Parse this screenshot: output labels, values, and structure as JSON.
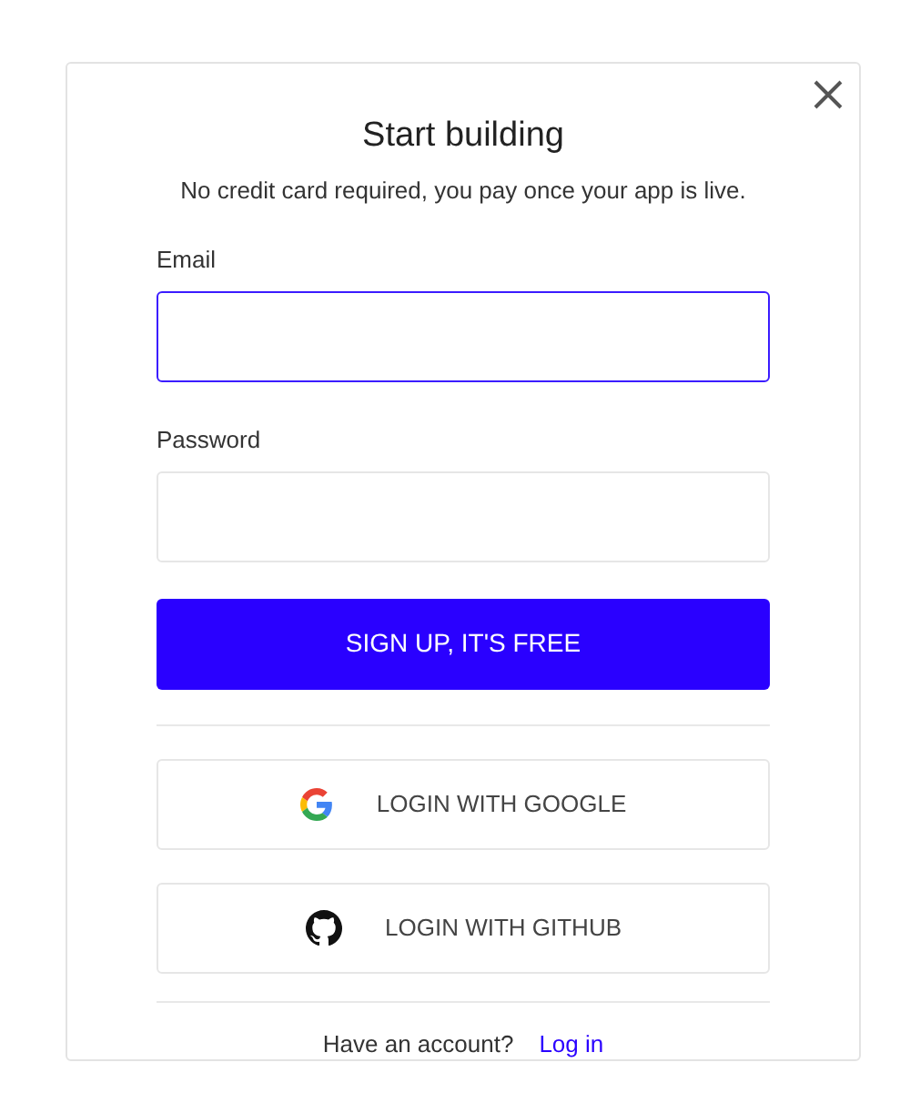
{
  "dialog": {
    "title": "Start building",
    "subtitle": "No credit card required, you pay once your app is live."
  },
  "fields": [
    {
      "label": "Email",
      "focused": true
    },
    {
      "label": "Password",
      "focused": false
    }
  ],
  "primary_button": "SIGN UP, IT'S FREE",
  "social_buttons": [
    {
      "kind": "google",
      "label": "LOGIN WITH GOOGLE"
    },
    {
      "kind": "github",
      "label": "LOGIN WITH GITHUB"
    }
  ],
  "footer": {
    "text": "Have an account?",
    "link": "Log in"
  }
}
